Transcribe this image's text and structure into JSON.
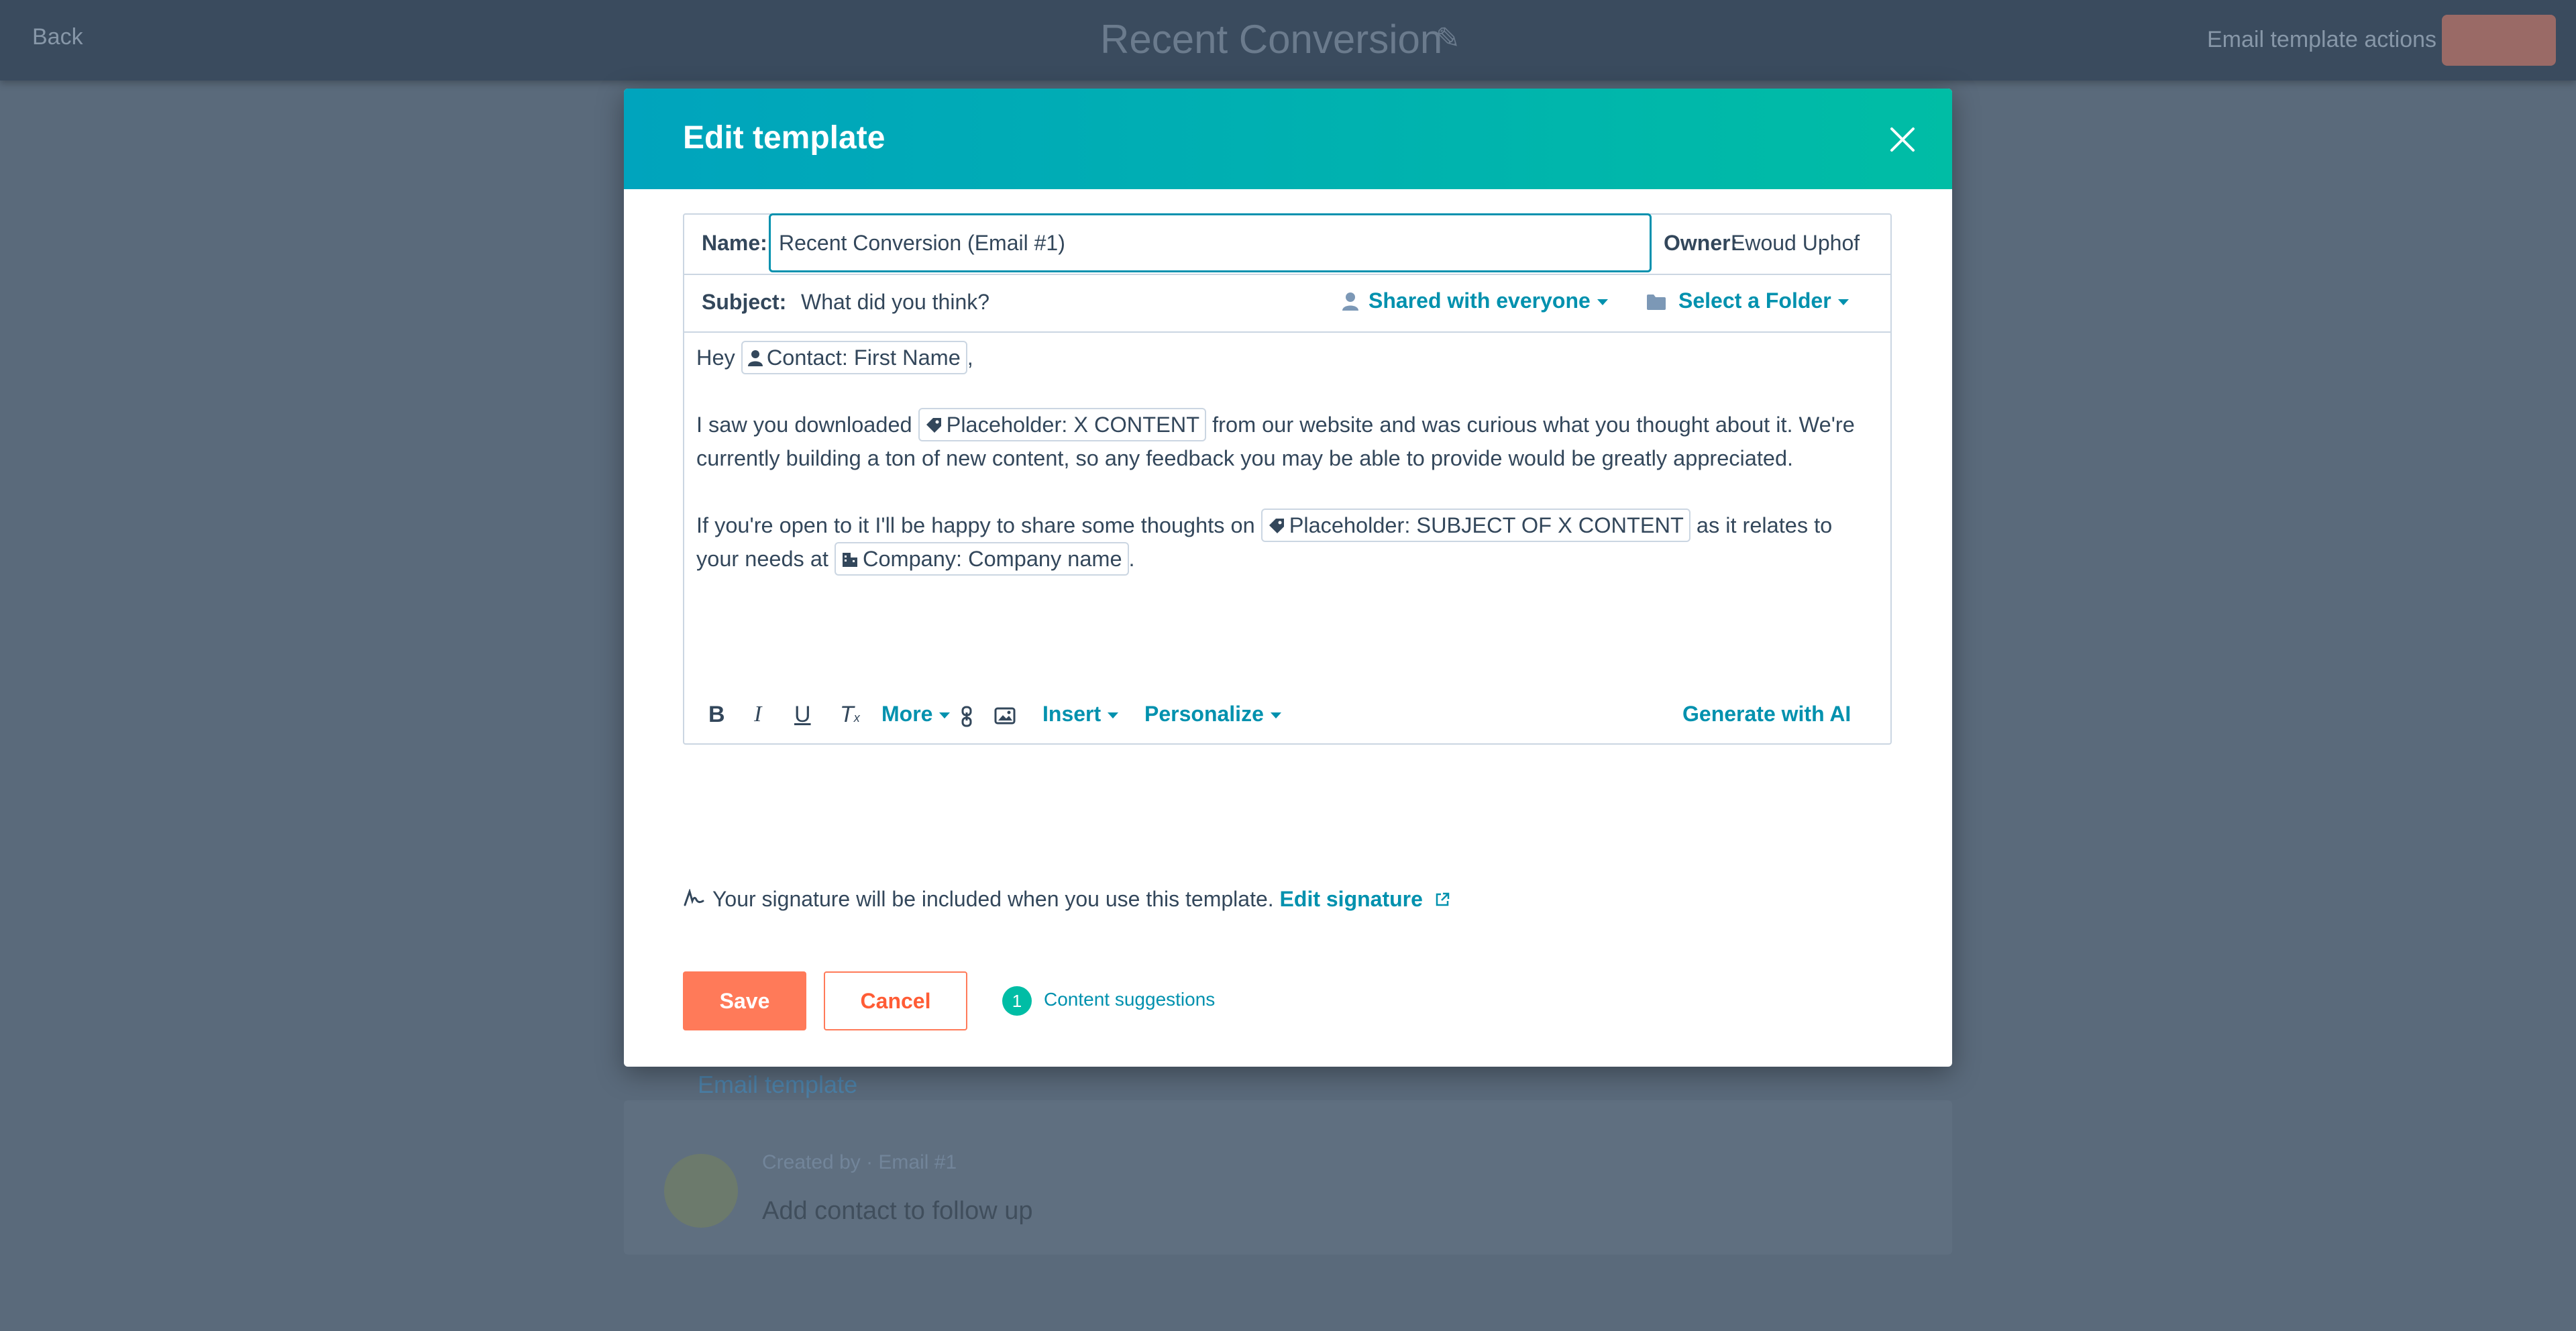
{
  "background": {
    "back_label": "Back",
    "title": "Recent Conversion",
    "link_label": "Email template actions",
    "card_title": "Email template",
    "card_meta": "Created by · Email #1",
    "card_task": "Add contact to follow up"
  },
  "modal": {
    "title": "Edit template",
    "name_label": "Name:",
    "name_value": "Recent Conversion (Email #1)",
    "owner_label": "Owner:",
    "owner_value": "Ewoud Uphof",
    "subject_label": "Subject:",
    "subject_value": "What did you think?",
    "shared_dropdown": "Shared with everyone",
    "folder_dropdown": "Select a Folder",
    "body": {
      "greeting": "Hey",
      "greeting_end": ",",
      "token_first_name": "Contact: First Name",
      "p2_start": "I saw you downloaded",
      "token_x_content": "Placeholder: X CONTENT",
      "p2_end": "from our website and was curious what you thought about it. We're currently building a ton of new content, so any feedback you may be able to provide would be greatly appreciated.",
      "p3_start": "If you're open to it I'll be happy to share some thoughts on",
      "token_subject": "Placeholder: SUBJECT OF X CONTENT",
      "p3_mid": "as it relates to your needs at",
      "token_company": "Company: Company name",
      "p3_end": "."
    },
    "toolbar": {
      "bold": "B",
      "italic": "I",
      "underline": "U",
      "clear_format": "T",
      "more": "More",
      "insert": "Insert",
      "personalize": "Personalize",
      "generate_ai": "Generate with AI"
    },
    "signature_text": "Your signature will be included when you use this template.",
    "edit_signature": "Edit signature",
    "save_label": "Save",
    "cancel_label": "Cancel",
    "suggestion_count": "1",
    "suggestion_label": "Content suggestions"
  },
  "colors": {
    "accent": "#0091ae",
    "header_start": "#00a4bd",
    "header_end": "#00bda5",
    "primary_button": "#ff7a59",
    "overlay": "#5a6a7b"
  }
}
